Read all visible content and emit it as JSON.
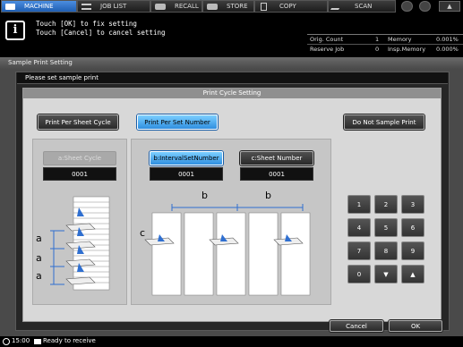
{
  "tabs": [
    {
      "label": "MACHINE",
      "active": true
    },
    {
      "label": "JOB LIST",
      "active": false
    },
    {
      "label": "RECALL",
      "active": false
    },
    {
      "label": "STORE",
      "active": false
    },
    {
      "label": "COPY",
      "active": false
    },
    {
      "label": "SCAN",
      "active": false
    }
  ],
  "message": {
    "line1": "Touch [OK] to fix setting",
    "line2": "Touch [Cancel] to cancel setting"
  },
  "counters": {
    "orig_count_label": "Orig. Count",
    "orig_count_value": "1",
    "memory_label": "Memory",
    "memory_value": "0.001%",
    "reserve_job_label": "Reserve Job",
    "reserve_job_value": "0",
    "insp_memory_label": "Insp.Memory",
    "insp_memory_value": "0.000%"
  },
  "window": {
    "title": "Sample Print Setting",
    "prompt": "Please set sample print",
    "section_title": "Print Cycle Setting"
  },
  "modes": {
    "per_sheet_cycle": "Print Per Sheet Cycle",
    "per_set_number": "Print Per Set Number",
    "do_not_sample": "Do Not Sample Print"
  },
  "settings": {
    "sheet_cycle_label": "a:Sheet Cycle",
    "sheet_cycle_value": "0001",
    "interval_label": "b:IntervalSetNumber",
    "interval_value": "0001",
    "sheet_number_label": "c:Sheet Number",
    "sheet_number_value": "0001"
  },
  "diagram_labels": {
    "a": "a",
    "b": "b",
    "c": "c"
  },
  "keypad": [
    "1",
    "2",
    "3",
    "4",
    "5",
    "6",
    "7",
    "8",
    "9",
    "0",
    "▼",
    "▲"
  ],
  "actions": {
    "cancel": "Cancel",
    "ok": "OK"
  },
  "status": {
    "time": "15:00",
    "text": "Ready to receive"
  }
}
